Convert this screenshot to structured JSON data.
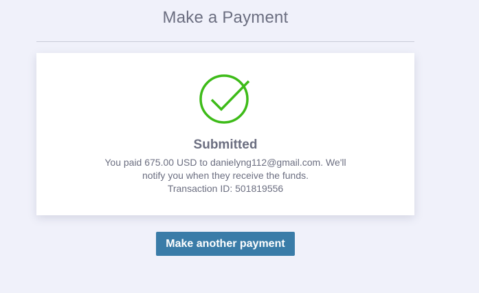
{
  "header": {
    "title": "Make a Payment"
  },
  "confirmation": {
    "icon": "check-circle-icon",
    "title": "Submitted",
    "lines": [
      "You paid 675.00 USD to danielyng112@gmail.com. We'll",
      "notify you when they receive the funds.",
      "Transaction ID: 501819556"
    ]
  },
  "actions": {
    "make_another_label": "Make another payment"
  },
  "colors": {
    "background": "#f0f1fa",
    "success": "#3dbb18",
    "text": "#6b6e80",
    "button": "#3a7ca8"
  }
}
